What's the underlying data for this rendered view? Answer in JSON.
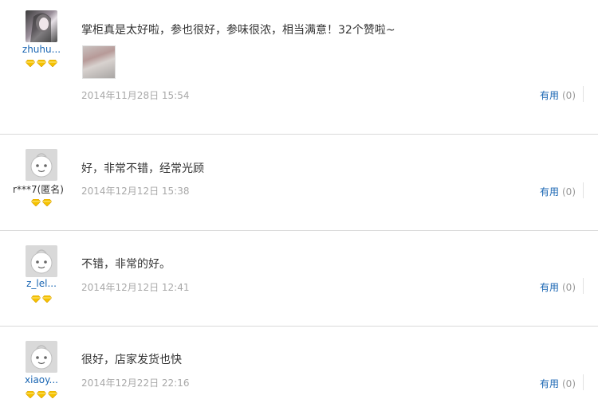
{
  "reviews": [
    {
      "username": "zhuhu...",
      "avatar": "user-photo",
      "level_diamonds": 3,
      "text": "掌柜真是太好啦，参也很好，参味很浓，相当满意！32个赞啦~",
      "has_photo": true,
      "date": "2014年11月28日 15:54",
      "useful_label": "有用",
      "useful_count": "(0)"
    },
    {
      "username": "r***7(匿名)",
      "avatar": "default-avatar",
      "level_diamonds": 2,
      "text": "好，非常不错，经常光顾",
      "has_photo": false,
      "date": "2014年12月12日 15:38",
      "useful_label": "有用",
      "useful_count": "(0)"
    },
    {
      "username": "z_lel...",
      "avatar": "default-avatar",
      "level_diamonds": 2,
      "text": "不错，非常的好。",
      "has_photo": false,
      "date": "2014年12月12日 12:41",
      "useful_label": "有用",
      "useful_count": "(0)"
    },
    {
      "username": "xiaoy...",
      "avatar": "default-avatar",
      "level_diamonds": 3,
      "text": "很好，店家发货也快",
      "has_photo": false,
      "date": "2014年12月22日 22:16",
      "useful_label": "有用",
      "useful_count": "(0)"
    }
  ],
  "colors": {
    "link": "#1a66b3",
    "text": "#333333",
    "meta": "#a8a8a8",
    "diamond": "#f5c200",
    "divider": "#d9d9d9"
  }
}
